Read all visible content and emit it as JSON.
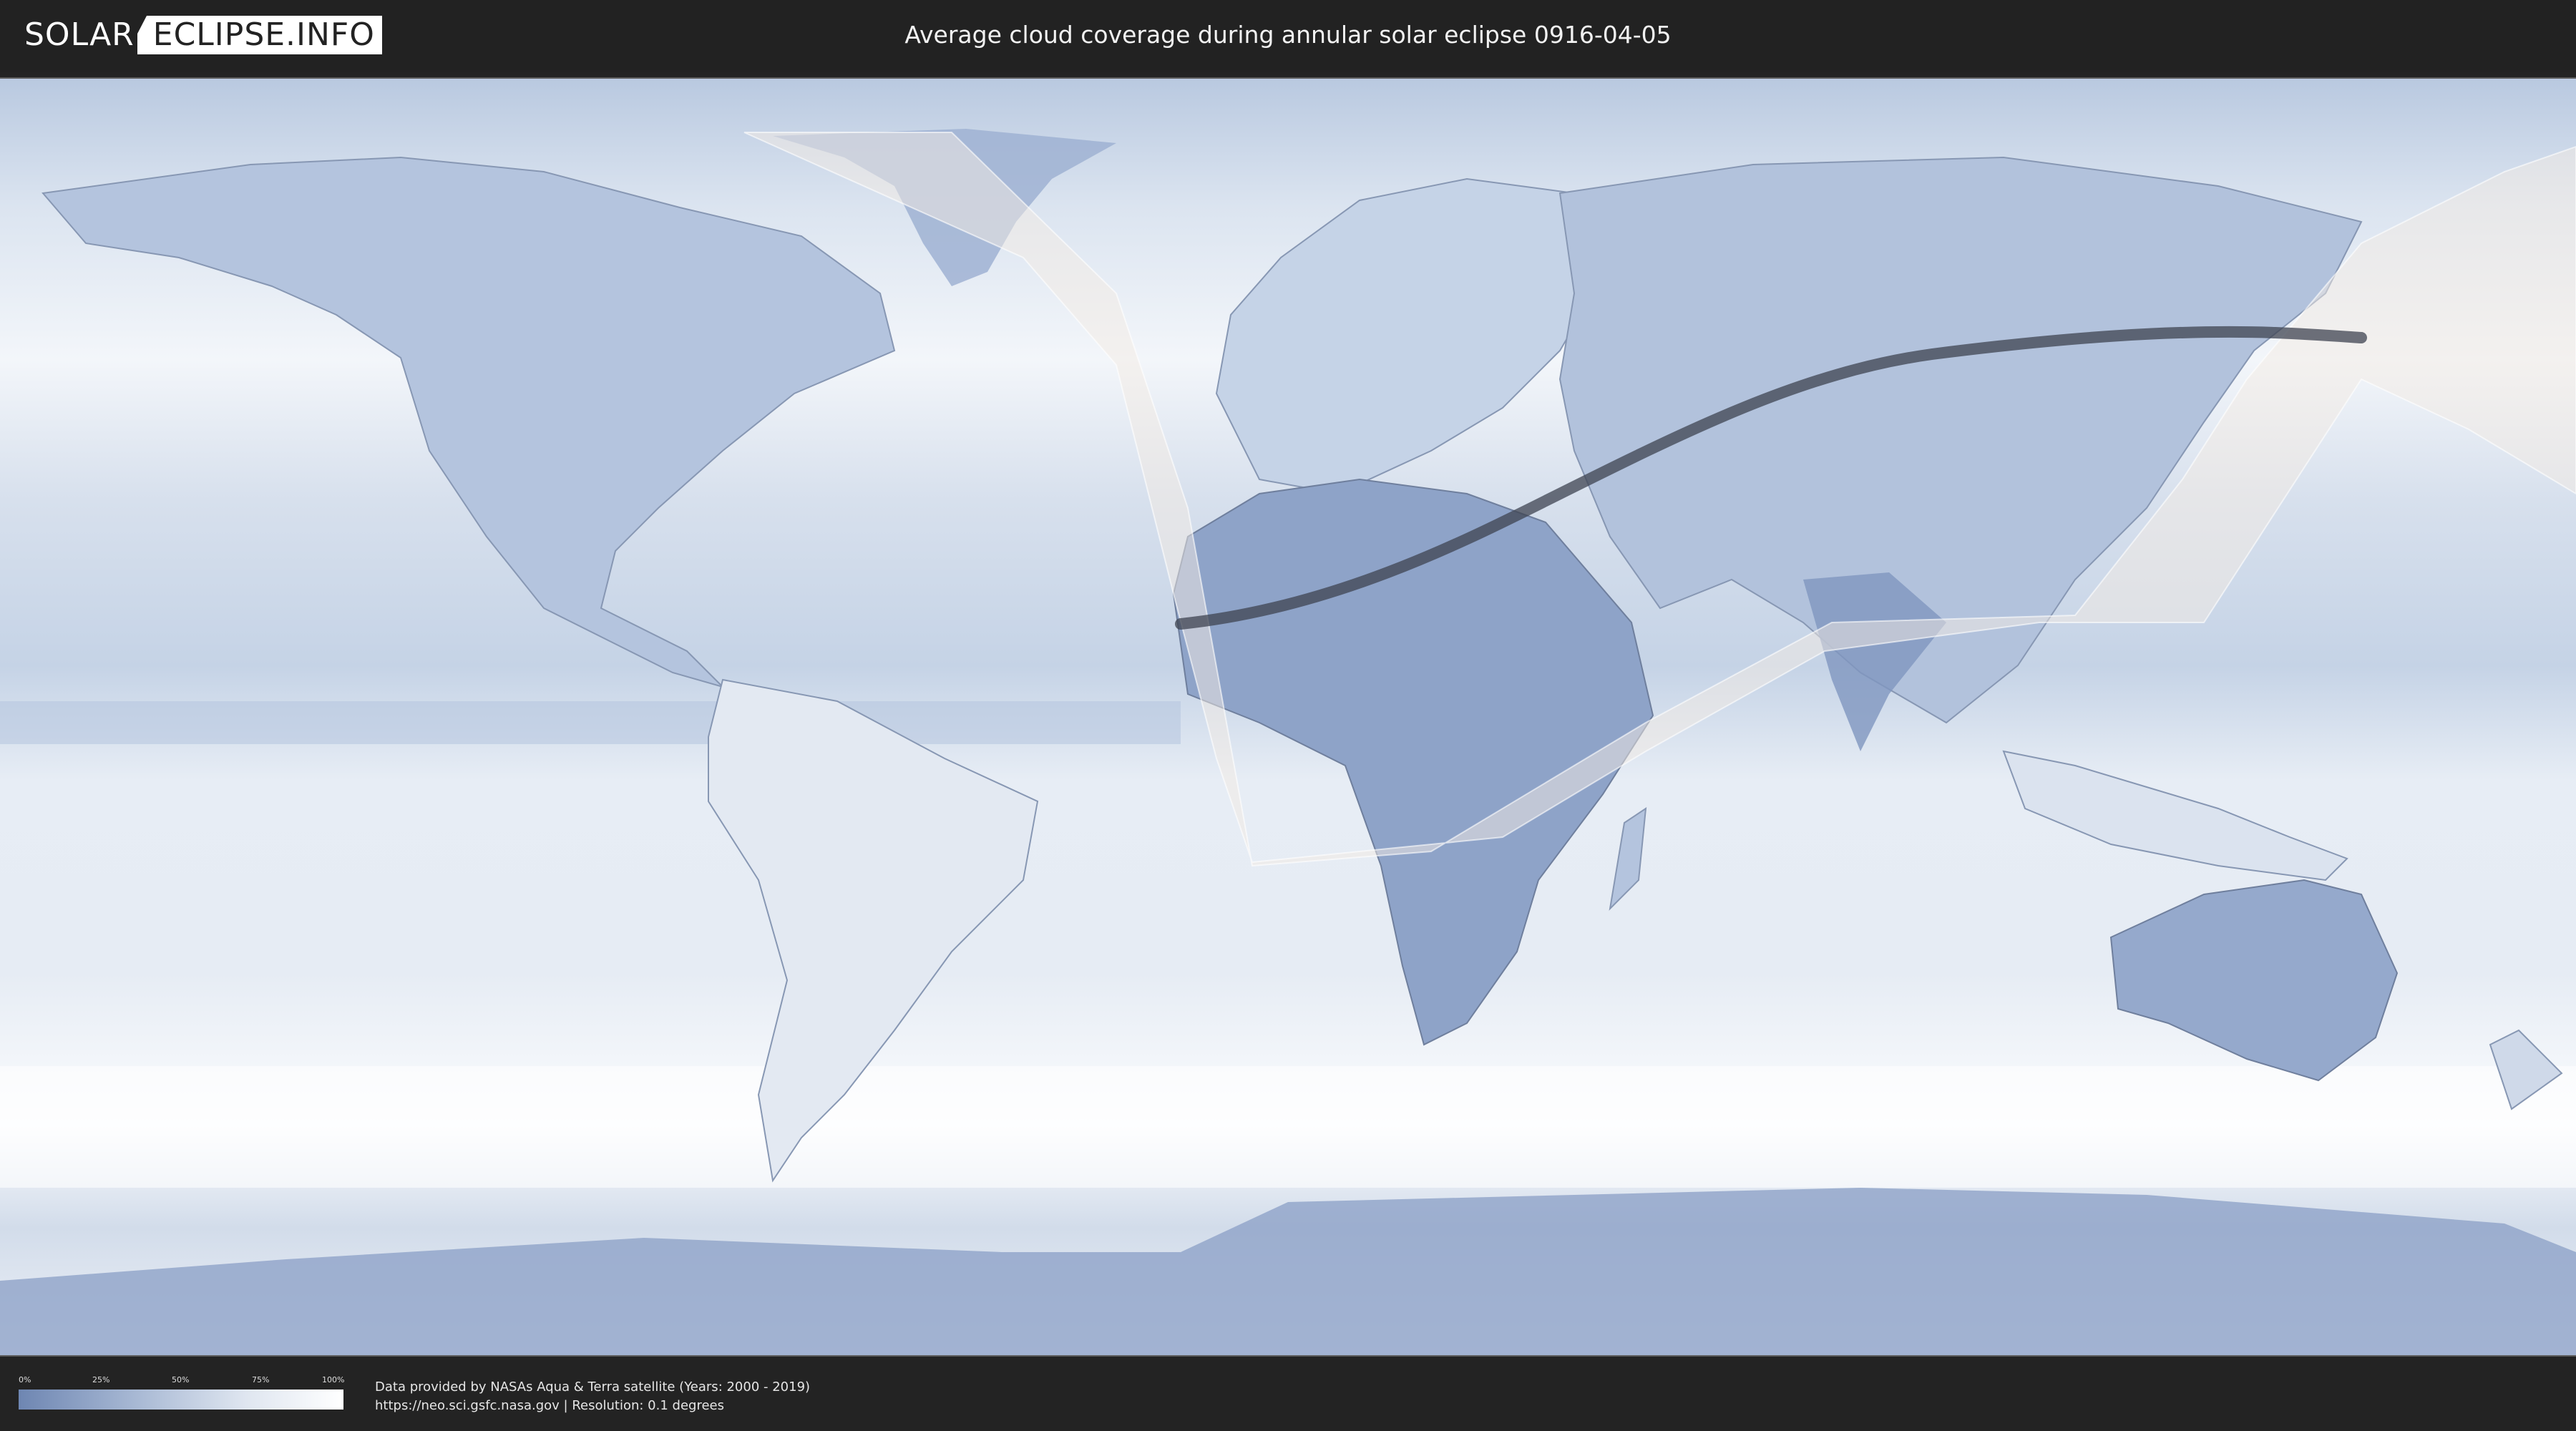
{
  "header": {
    "logo": {
      "part1": "SOLAR",
      "part2": "ECLIPSE.INFO"
    },
    "title": "Average cloud coverage during annular solar eclipse 0916-04-05"
  },
  "map": {
    "layer": "average-cloud-coverage",
    "projection": "equirectangular",
    "colors": {
      "clear": "#6e86b2",
      "cloudy": "#ffffff",
      "eclipse_path": "#3d4350",
      "visibility_overlay": "#f3ece3"
    }
  },
  "legend": {
    "ticks": [
      "0%",
      "25%",
      "50%",
      "75%",
      "100%"
    ],
    "gradient": [
      "#6e86b2",
      "#a6b7d3",
      "#dfe6f0",
      "#ffffff"
    ]
  },
  "credits": {
    "line1": "Data provided by NASAs Aqua & Terra satellite (Years: 2000 - 2019)",
    "line2": "https://neo.sci.gsfc.nasa.gov | Resolution: 0.1 degrees"
  }
}
